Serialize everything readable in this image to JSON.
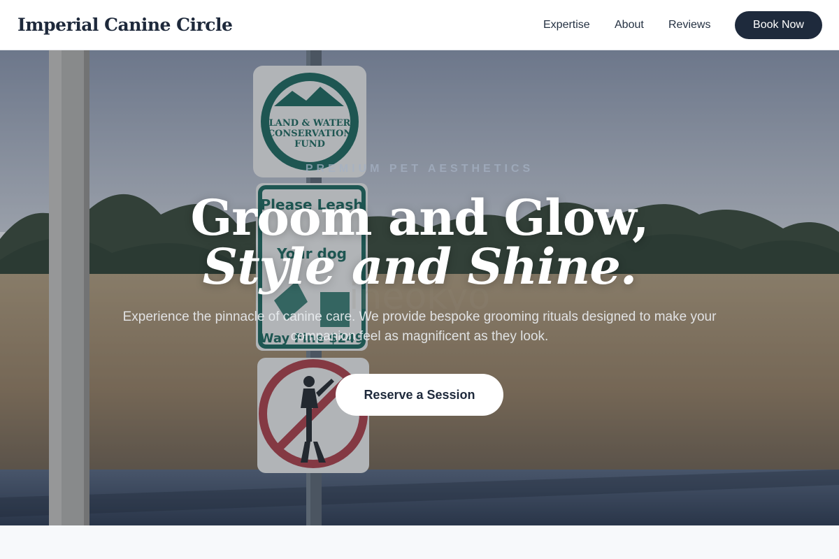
{
  "header": {
    "brand": "Imperial Canine Circle",
    "nav": [
      {
        "label": "Expertise"
      },
      {
        "label": "About"
      },
      {
        "label": "Reviews"
      }
    ],
    "cta_label": "Book Now"
  },
  "hero": {
    "eyebrow": "PREMIUM PET AESTHETICS",
    "headline_line1": "Groom and Glow,",
    "headline_line2": "Style and Shine.",
    "subtext": "Experience the pinnacle of canine care. We provide bespoke grooming rituals designed to make your companion feel as magnificent as they look.",
    "cta_label": "Reserve a Session",
    "background": {
      "sign_top_lines": [
        "LAND & WATER",
        "CONSERVATION",
        "FUND"
      ],
      "sign_middle_lines": [
        "Please Leash",
        "Your dog",
        "Way Fine $249"
      ]
    }
  },
  "colors": {
    "primary": "#1e2a3c",
    "text_dark": "#1e293b",
    "white": "#ffffff"
  },
  "icons": [
    "no-golf-sign-icon",
    "land-and-water-fund-seal-icon"
  ]
}
